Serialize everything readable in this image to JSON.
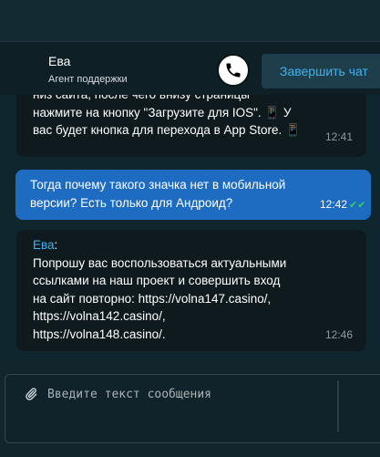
{
  "header": {
    "agent_name": "Ева",
    "agent_role": "Агент поддержки",
    "end_chat_label": "Завершить чат",
    "call_icon": "phone-icon"
  },
  "messages": [
    {
      "direction": "in",
      "text": "низ сайта, после чего внизу страницы\nнажмите на кнопку \"Загрузите для IOS\". 📱 У\nвас будет кнопка для перехода в App Store. 📱",
      "time": "12:41"
    },
    {
      "direction": "out",
      "text": "Тогда почему такого значка нет в мобильной\nверсии? Есть только для Андроид?",
      "time": "12:42",
      "status": "read"
    },
    {
      "direction": "in",
      "sender": "Ева",
      "text": "Попрошу вас воспользоваться актуальными\nссылками на наш проект и совершить вход\nна сайт повторно: https://volna147.casino/,\nhttps://volna142.casino/,\nhttps://volna148.casino/.",
      "time": "12:46"
    }
  ],
  "composer": {
    "placeholder": "Введите текст сообщения",
    "value": "",
    "attach_icon": "paperclip-icon"
  },
  "colors": {
    "accent": "#3fb3f0",
    "outgoing_bubble": "#1d6cc1",
    "incoming_bubble": "#0f1a1f",
    "read_ticks": "#2fd06a"
  }
}
